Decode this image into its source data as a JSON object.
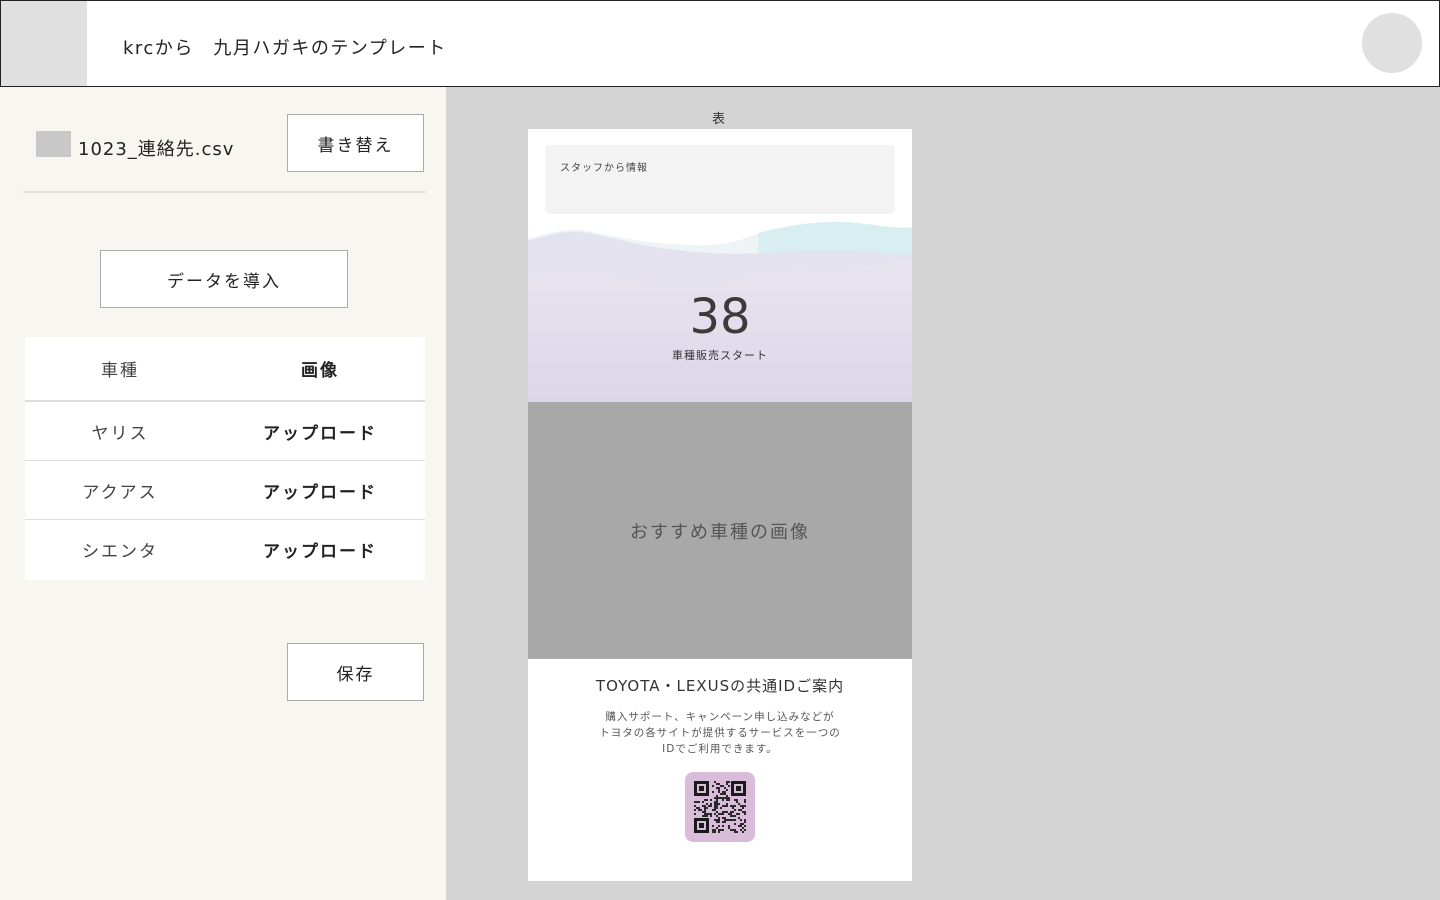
{
  "header": {
    "title": "krcから　九月ハガキのテンプレート"
  },
  "sidebar": {
    "file_name": "1023_連絡先.csv",
    "replace_label": "書き替え",
    "import_label": "データを導入",
    "table": {
      "headers": [
        "車種",
        "画像"
      ],
      "rows": [
        {
          "model": "ヤリス",
          "action": "アップロード"
        },
        {
          "model": "アクアス",
          "action": "アップロード"
        },
        {
          "model": "シエンタ",
          "action": "アップロード"
        }
      ]
    },
    "save_label": "保存"
  },
  "preview": {
    "face_label": "表",
    "staff_text": "スタッフから情報",
    "hero_number": "38",
    "hero_sub": "車種販売スタート",
    "image_placeholder": "おすすめ車種の画像",
    "id_title": "TOYOTA・LEXUSの共通IDご案内",
    "id_desc_lines": [
      "購入サポート、キャンペーン申し込みなどが",
      "トヨタの各サイトが提供するサービスを一つの",
      "IDでご利用できます。"
    ]
  },
  "colors": {
    "sidebar_bg": "#f8f6f1",
    "canvas_bg": "#d4d4d4",
    "hero_purple": "#ddd8e8",
    "image_gray": "#a8a8a8",
    "qr_bg": "#d9bcd9"
  }
}
